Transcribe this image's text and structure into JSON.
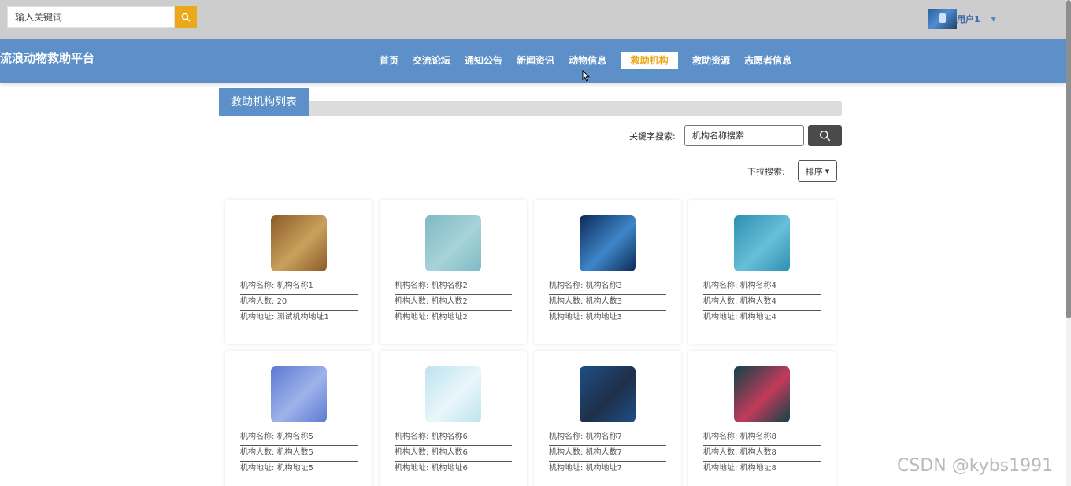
{
  "header": {
    "search_placeholder": "输入关键词",
    "username": "用户1"
  },
  "nav": {
    "site_title": "流浪动物救助平台",
    "items": [
      {
        "label": "首页"
      },
      {
        "label": "交流论坛"
      },
      {
        "label": "通知公告"
      },
      {
        "label": "新闻资讯"
      },
      {
        "label": "动物信息"
      },
      {
        "label": "救助机构",
        "active": true
      },
      {
        "label": "救助资源"
      },
      {
        "label": "志愿者信息"
      }
    ]
  },
  "section": {
    "title": "救助机构列表",
    "keyword_label": "关键字搜索:",
    "keyword_placeholder": "机构名称搜索",
    "dropdown_label": "下拉搜索:",
    "sort_label": "排序"
  },
  "field_labels": {
    "name": "机构名称:",
    "count": "机构人数:",
    "address": "机构地址:"
  },
  "cards": [
    {
      "name": "机构名称1",
      "count": "20",
      "address": "测试机构地址1",
      "colors": [
        "#8a5a2b",
        "#c9a15b"
      ]
    },
    {
      "name": "机构名称2",
      "count": "机构人数2",
      "address": "机构地址2",
      "colors": [
        "#7fb9c4",
        "#a7d3d9"
      ]
    },
    {
      "name": "机构名称3",
      "count": "机构人数3",
      "address": "机构地址3",
      "colors": [
        "#0c2a56",
        "#3e86c9"
      ]
    },
    {
      "name": "机构名称4",
      "count": "机构人数4",
      "address": "机构地址4",
      "colors": [
        "#2d8fb3",
        "#67bfd8"
      ]
    },
    {
      "name": "机构名称5",
      "count": "机构人数5",
      "address": "机构地址5",
      "colors": [
        "#5c7ad1",
        "#9fb2ea"
      ]
    },
    {
      "name": "机构名称6",
      "count": "机构人数6",
      "address": "机构地址6",
      "colors": [
        "#bfe3ef",
        "#e9f6fa"
      ]
    },
    {
      "name": "机构名称7",
      "count": "机构人数7",
      "address": "机构地址7",
      "colors": [
        "#1d4f86",
        "#1f2f4a"
      ]
    },
    {
      "name": "机构名称8",
      "count": "机构人数8",
      "address": "机构地址8",
      "colors": [
        "#0e4348",
        "#c23a5a"
      ]
    }
  ],
  "watermark": "CSDN @kybs1991",
  "colors": {
    "topbar": "#cdcdcd",
    "navbar": "#5d90c8",
    "accent": "#eba81a"
  }
}
